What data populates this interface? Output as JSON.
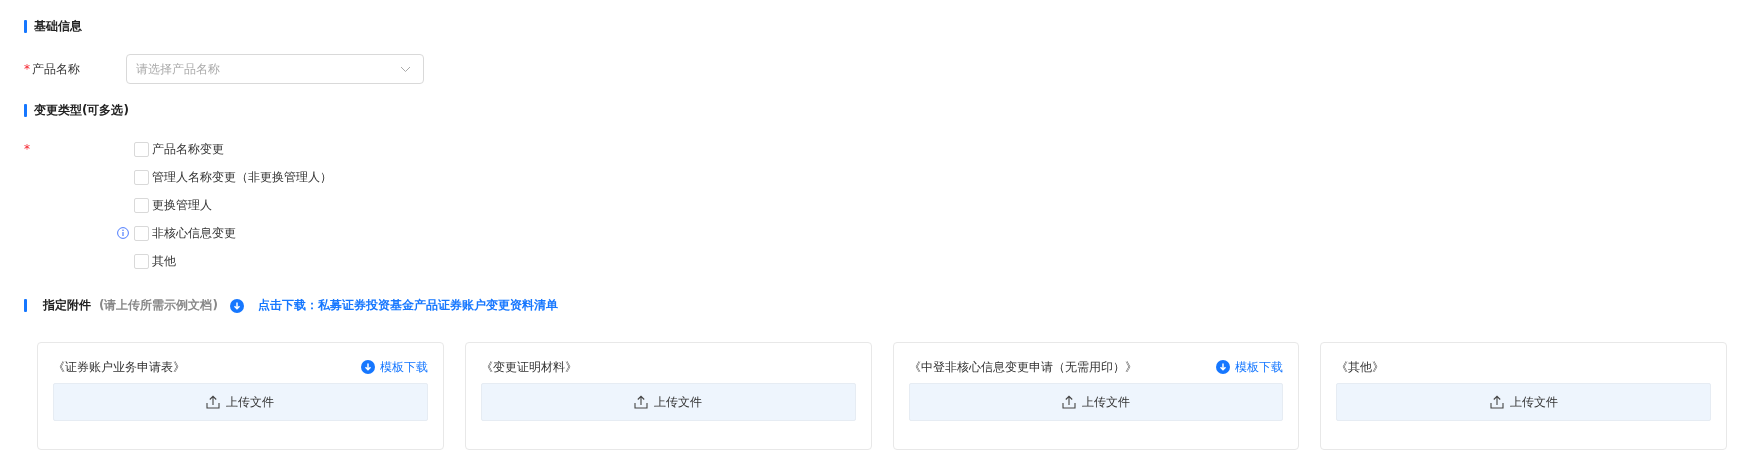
{
  "basic_info": {
    "title": "基础信息",
    "product_field": {
      "required_mark": "*",
      "label": "产品名称",
      "placeholder": "请选择产品名称"
    }
  },
  "change_type": {
    "title": "变更类型(可多选)",
    "required_mark": "*",
    "options": [
      {
        "label": "产品名称变更",
        "checked": false,
        "info": false
      },
      {
        "label": "管理人名称变更（非更换管理人）",
        "checked": false,
        "info": false
      },
      {
        "label": "更换管理人",
        "checked": false,
        "info": false
      },
      {
        "label": "非核心信息变更",
        "checked": false,
        "info": true
      },
      {
        "label": "其他",
        "checked": false,
        "info": false
      }
    ]
  },
  "attachments": {
    "title": "指定附件",
    "hint": "(请上传所需示例文档)",
    "download_link": "点击下载：私募证券投资基金产品证券账户变更资料清单",
    "cards": [
      {
        "title": "《证券账户业务申请表》",
        "template_link": "模板下载",
        "upload_label": "上传文件"
      },
      {
        "title": "《变更证明材料》",
        "upload_label": "上传文件"
      },
      {
        "title": "《中登非核心信息变更申请（无需用印）》",
        "template_link": "模板下载",
        "upload_label": "上传文件"
      },
      {
        "title": "《其他》",
        "upload_label": "上传文件"
      }
    ]
  }
}
